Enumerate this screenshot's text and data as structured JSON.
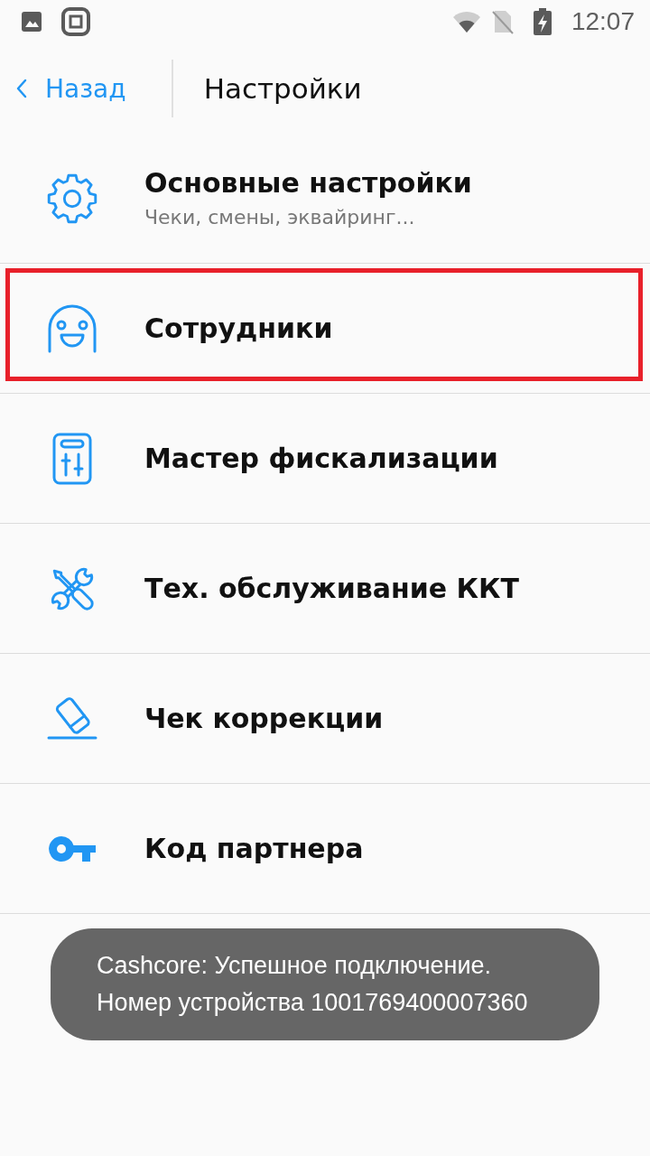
{
  "status_bar": {
    "time": "12:07"
  },
  "header": {
    "back_label": "Назад",
    "title": "Настройки"
  },
  "items": [
    {
      "title": "Основные настройки",
      "subtitle": "Чеки, смены, эквайринг...",
      "highlighted": false
    },
    {
      "title": "Сотрудники",
      "highlighted": true
    },
    {
      "title": "Мастер фискализации",
      "highlighted": false
    },
    {
      "title": "Тех. обслуживание ККТ",
      "highlighted": false
    },
    {
      "title": "Чек коррекции",
      "highlighted": false
    },
    {
      "title": "Код партнера",
      "highlighted": false
    }
  ],
  "toast": {
    "text": "Cashcore: Успешное подключение.\nНомер устройства 1001769400007360"
  }
}
